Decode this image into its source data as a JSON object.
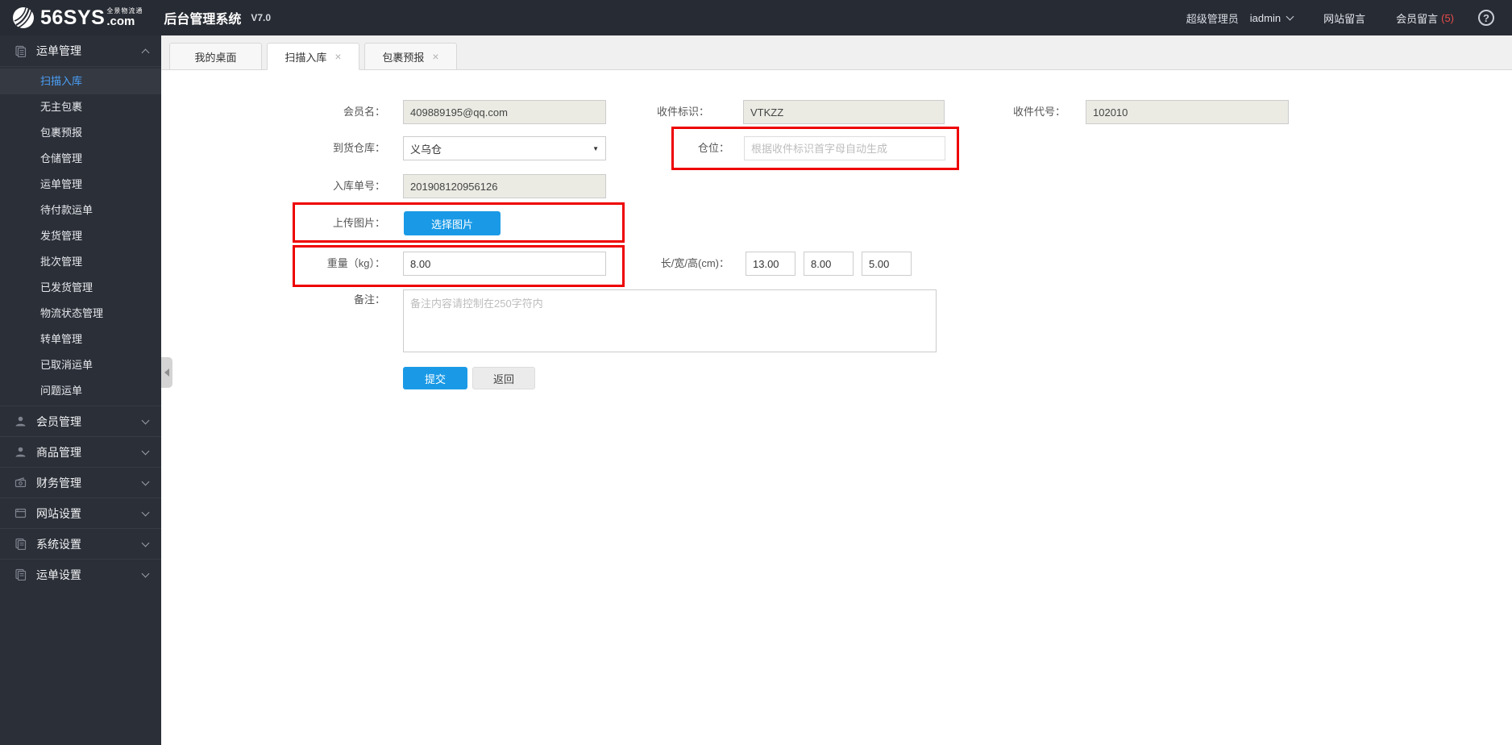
{
  "icons": {
    "close": "×",
    "dropdown": "▼",
    "help": "?"
  },
  "header": {
    "logo_main": "56SYS",
    "logo_tagline": "全景物流通",
    "logo_domain": ".com",
    "app_title": "后台管理系统",
    "version": "V7.0",
    "role": "超级管理员",
    "username": "iadmin",
    "site_messages": "网站留言",
    "member_messages": "会员留言",
    "member_messages_count": "(5)"
  },
  "sidebar": {
    "main_group": "运单管理",
    "sub": [
      "扫描入库",
      "无主包裹",
      "包裹预报",
      "仓储管理",
      "运单管理",
      "待付款运单",
      "发货管理",
      "批次管理",
      "已发货管理",
      "物流状态管理",
      "转单管理",
      "已取消运单",
      "问题运单"
    ],
    "groups": [
      "会员管理",
      "商品管理",
      "财务管理",
      "网站设置",
      "系统设置",
      "运单设置"
    ]
  },
  "tabs": [
    {
      "label": "我的桌面"
    },
    {
      "label": "扫描入库"
    },
    {
      "label": "包裹预报"
    }
  ],
  "form": {
    "member_name": {
      "label": "会员名：",
      "value": "409889195@qq.com"
    },
    "recipient_mark": {
      "label": "收件标识：",
      "value": "VTKZZ"
    },
    "recipient_code": {
      "label": "收件代号：",
      "value": "102010"
    },
    "arrival_warehouse": {
      "label": "到货仓库：",
      "value": "义乌仓"
    },
    "slot": {
      "label": "仓位：",
      "placeholder": "根据收件标识首字母自动生成"
    },
    "inbound_no": {
      "label": "入库单号：",
      "value": "201908120956126"
    },
    "upload": {
      "label": "上传图片：",
      "button_label": "选择图片"
    },
    "weight": {
      "label": "重量（kg）：",
      "value": "8.00"
    },
    "dims": {
      "label": "长/宽/高(cm)：",
      "length": "13.00",
      "width": "8.00",
      "height": "5.00"
    },
    "remark": {
      "label": "备注：",
      "placeholder": "备注内容请控制在250字符内"
    },
    "submit_label": "提交",
    "back_label": "返回"
  },
  "colors": {
    "accent_blue": "#1a9ae6",
    "highlight_red": "#ee0000",
    "count_red": "#e84c4c",
    "header_bg": "#272b33",
    "sidebar_bg": "#2b2f38",
    "active_link": "#4aa0f7"
  }
}
